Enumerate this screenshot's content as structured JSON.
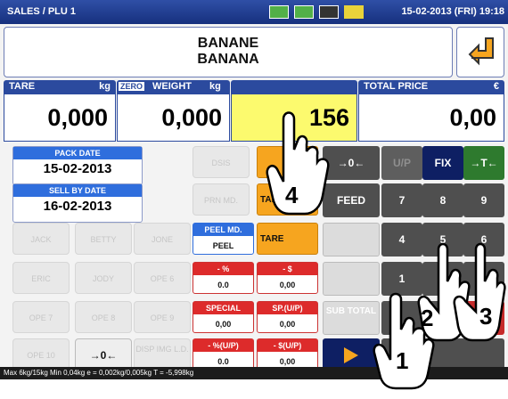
{
  "titlebar": {
    "title": "SALES / PLU 1",
    "datetime": "15-02-2013 (FRI) 19:18"
  },
  "product": {
    "name_line1": "BANANE",
    "name_line2": "BANANA"
  },
  "values": {
    "tare_label": "TARE",
    "tare_unit": "kg",
    "tare": "0,000",
    "zero_badge": "ZERO",
    "weight_label": "WEIGHT",
    "weight_unit": "kg",
    "weight": "0,000",
    "unit_price": "156",
    "total_label": "TOTAL PRICE",
    "total_unit": "€",
    "total": "0,00"
  },
  "dates": {
    "pack_label": "PACK DATE",
    "pack": "15-02-2013",
    "sell_label": "SELL BY DATE",
    "sell": "16-02-2013"
  },
  "left_buttons": {
    "dsis": "DSIS",
    "prn_md": "PRN MD.",
    "jack": "JACK",
    "betty": "BETTY",
    "jone": "JONE",
    "eric": "ERIC",
    "jody": "JODY",
    "ope6": "OPE 6",
    "ope7": "OPE 7",
    "ope8": "OPE 8",
    "ope9": "OPE 9",
    "ope10": "OPE 10",
    "zero": "→0←",
    "disp_img": "DISP IMG L.D."
  },
  "mid_buttons": {
    "peel_md": "PEEL MD.",
    "peel": "PEEL",
    "pct": "- %",
    "pct_val": "0.0",
    "dollar": "- $",
    "dollar_val": "0,00",
    "special": "SPECIAL",
    "special_val": "0,00",
    "sp_up": "SP.(U/P)",
    "sp_up_val": "0,00",
    "pct_up": "- %(U/P)",
    "pct_up_val": "0.0",
    "dollar_up": "- $(U/P)",
    "dollar_up_val": "0,00",
    "tare_a": "TARE",
    "tare_b": "TARE"
  },
  "keypad": {
    "zero": "→0←",
    "up": "U/P",
    "fix": "FIX",
    "tare": "→T←",
    "feed": "FEED",
    "k7": "7",
    "k8": "8",
    "k9": "9",
    "k4": "4",
    "k5": "5",
    "k6": "6",
    "k1": "1",
    "sub_total": "SUB TOTAL"
  },
  "footer": {
    "text": "Max 6kg/15kg  Min 0,04kg  e = 0,002kg/0,005kg  T = -5,998kg"
  },
  "hands": {
    "h4": "4",
    "h1": "1",
    "h2": "2",
    "h3": "3"
  },
  "colors": {
    "header_blue": "#2b4a9e",
    "unit_price_bg": "#fcfa6e",
    "accent_orange": "#f6a51f",
    "discount_red": "#dd2b2b"
  }
}
